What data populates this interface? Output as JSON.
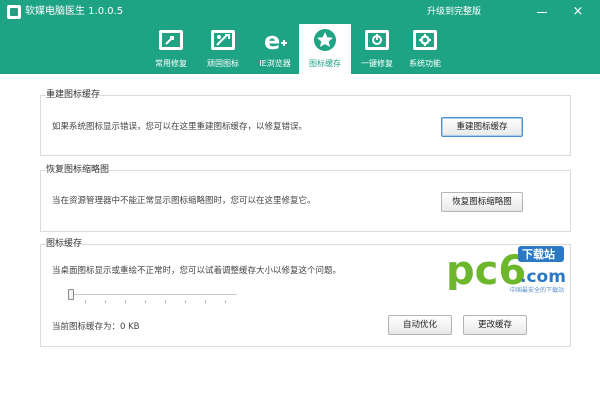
{
  "window": {
    "title": "软媒电脑医生 1.0.0.5",
    "upgrade_link": "升级到完整版",
    "minimize_glyph": "",
    "close_glyph": "×"
  },
  "toolbar": {
    "items": [
      {
        "label": "常用修复",
        "icon": "repair-icon"
      },
      {
        "label": "顽固图标",
        "icon": "stubborn-icon-tool-icon"
      },
      {
        "label": "IE浏览器",
        "icon": "ie-browser-icon"
      },
      {
        "label": "图标缓存",
        "icon": "star-icon",
        "active": true
      },
      {
        "label": "一键修复",
        "icon": "one-click-repair-icon"
      },
      {
        "label": "系统功能",
        "icon": "system-function-icon"
      }
    ]
  },
  "rebuild": {
    "title": "重建图标缓存",
    "text": "如果系统图标显示错误，您可以在这里重建图标缓存，以修复错误。",
    "button": "重建图标缓存"
  },
  "thumb": {
    "title": "恢复图标缩略图",
    "text": "当在资源管理器中不能正常显示图标缩略图时，您可以在这里修复它。",
    "button": "恢复图标缩略图"
  },
  "cache": {
    "title": "图标缓存",
    "text": "当桌面图标显示或重绘不正常时，您可以试着调整缓存大小以修复这个问题。",
    "slider_value": 0,
    "size_text": "当前图标缓存为：0 KB",
    "auto_button": "自动优化",
    "change_button": "更改缓存"
  },
  "watermark": {
    "pc6": "pc6",
    "download": "下载站",
    "com": ".com",
    "tagline": "中国最安全的下载站"
  },
  "colors": {
    "accent": "#1ea385",
    "watermark_green": "#6cb72b",
    "watermark_blue": "#2b79c2"
  }
}
